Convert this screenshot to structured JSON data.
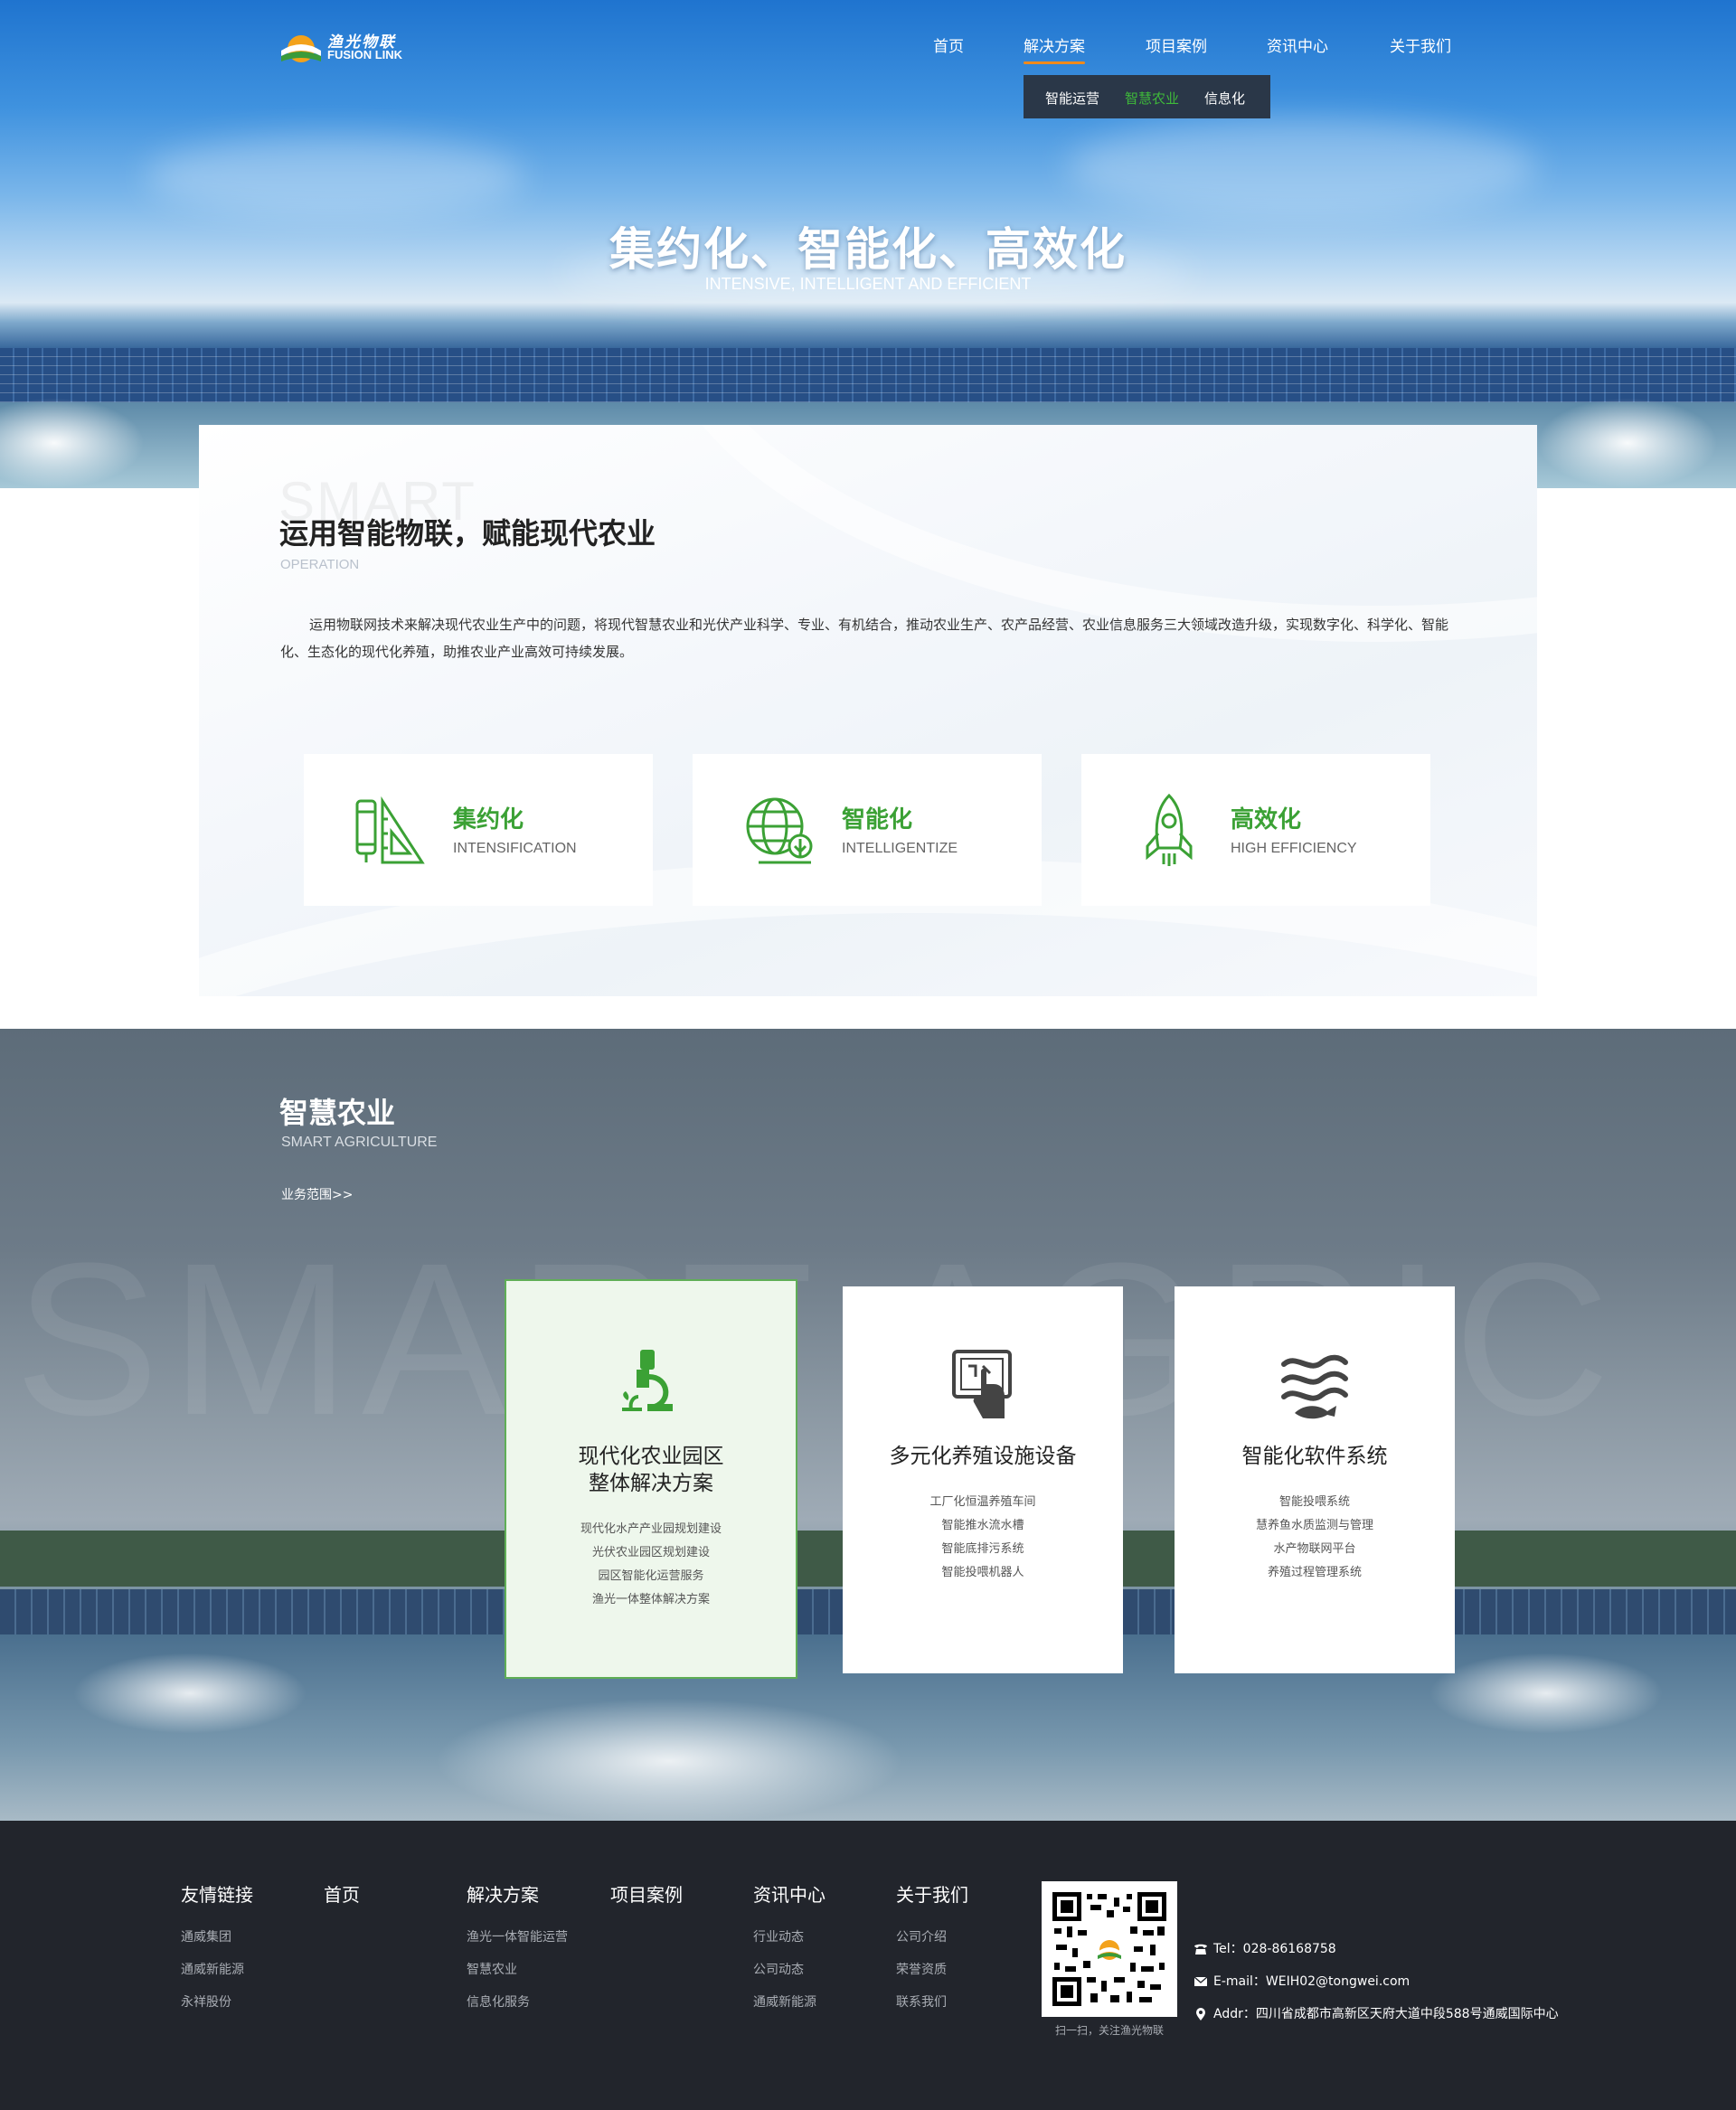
{
  "logo": {
    "cn": "渔光物联",
    "en": "FUSION LINK"
  },
  "nav": {
    "items": [
      "首页",
      "解决方案",
      "项目案例",
      "资讯中心",
      "关于我们"
    ],
    "active_index": 1,
    "sub_items": [
      "智能运营",
      "智慧农业",
      "信息化"
    ],
    "sub_active_index": 1
  },
  "hero": {
    "title": "集约化、智能化、高效化",
    "subtitle": "INTENSIVE, INTELLIGENT AND EFFICIENT"
  },
  "intro": {
    "bg_word": "SMART",
    "title": "运用智能物联，赋能现代农业",
    "title_en": "OPERATION",
    "description": "运用物联网技术来解决现代农业生产中的问题，将现代智慧农业和光伏产业科学、专业、有机结合，推动农业生产、农产品经营、农业信息服务三大领域改造升级，实现数字化、科学化、智能化、生态化的现代化养殖，助推农业产业高效可持续发展。",
    "features": [
      {
        "name": "集约化",
        "en": "INTENSIFICATION",
        "icon": "ruler-pencil-icon"
      },
      {
        "name": "智能化",
        "en": "INTELLIGENTIZE",
        "icon": "globe-plant-icon"
      },
      {
        "name": "高效化",
        "en": "HIGH EFFICIENCY",
        "icon": "rocket-icon"
      }
    ]
  },
  "agri": {
    "bg_word": "SMART AGRIC",
    "title": "智慧农业",
    "title_en": "SMART AGRICULTURE",
    "more": "业务范围>>",
    "cards": [
      {
        "title_line1": "现代化农业园区",
        "title_line2": "整体解决方案",
        "icon": "microscope-plant-icon",
        "items": [
          "现代化水产产业园规划建设",
          "光伏农业园区规划建设",
          "园区智能化运营服务",
          "渔光一体整体解决方案"
        ]
      },
      {
        "title_line1": "多元化养殖设施设备",
        "title_line2": "",
        "icon": "touch-screen-icon",
        "items": [
          "工厂化恒温养殖车间",
          "智能推水流水槽",
          "智能底排污系统",
          "智能投喂机器人"
        ]
      },
      {
        "title_line1": "智能化软件系统",
        "title_line2": "",
        "icon": "fish-waves-icon",
        "items": [
          "智能投喂系统",
          "慧养鱼水质监测与管理",
          "水产物联网平台",
          "养殖过程管理系统"
        ]
      }
    ]
  },
  "footer": {
    "columns": [
      {
        "title": "友情链接",
        "links": [
          "通威集团",
          "通威新能源",
          "永祥股份"
        ]
      },
      {
        "title": "首页",
        "links": []
      },
      {
        "title": "解决方案",
        "links": [
          "渔光一体智能运营",
          "智慧农业",
          "信息化服务"
        ]
      },
      {
        "title": "项目案例",
        "links": []
      },
      {
        "title": "资讯中心",
        "links": [
          "行业动态",
          "公司动态",
          "通威新能源"
        ]
      },
      {
        "title": "关于我们",
        "links": [
          "公司介绍",
          "荣誉资质",
          "联系我们"
        ]
      }
    ],
    "qr_caption": "扫一扫，关注渔光物联",
    "tel": "Tel：028-86168758",
    "email": "E-mail：WEIH02@tongwei.com",
    "addr": "Addr：四川省成都市高新区天府大道中段588号通威国际中心"
  },
  "colors": {
    "accent_green": "#3ba135",
    "nav_underline": "#f08a1c",
    "footer_bg": "#22252c",
    "subnav_bg": "#2a3748"
  }
}
